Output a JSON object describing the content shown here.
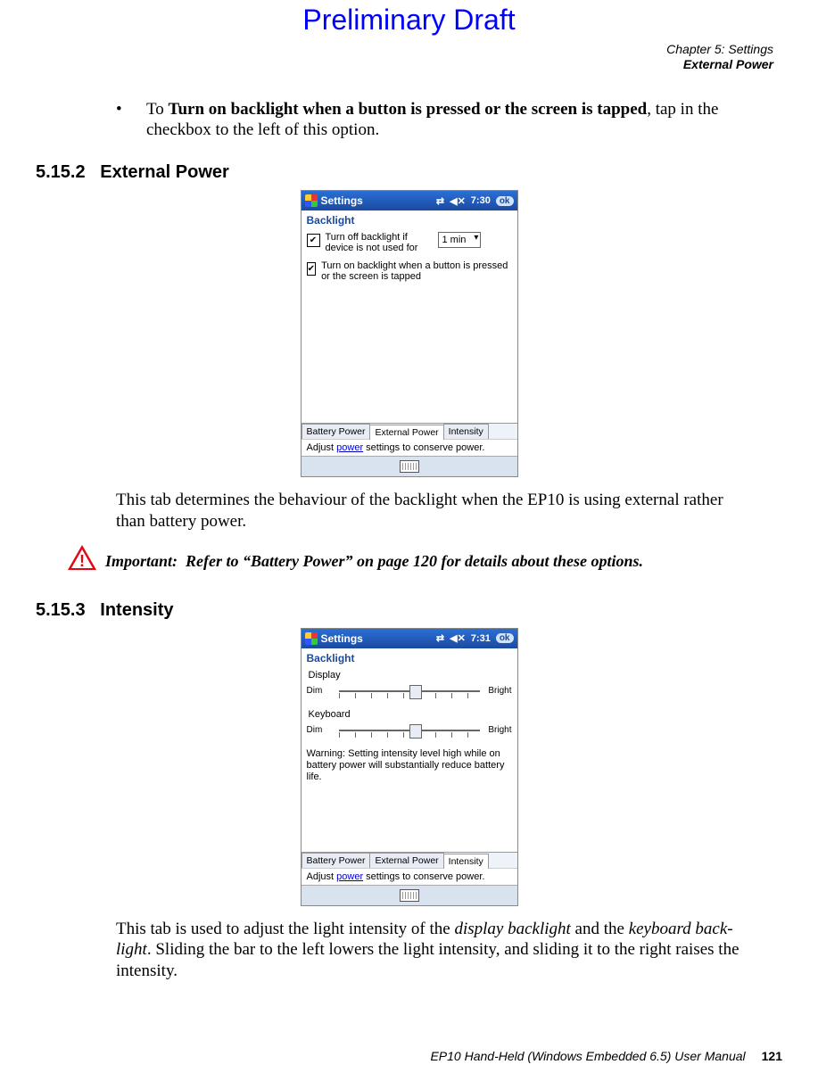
{
  "preliminary": "Preliminary Draft",
  "header": {
    "line1": "Chapter 5:  Settings",
    "line2": "External Power"
  },
  "bullet1": {
    "pre": "To ",
    "bold": "Turn on backlight when a button is pressed or the screen is tapped",
    "post": ", tap in the checkbox to the left of this option."
  },
  "sec1": {
    "num": "5.15.2",
    "title": "External Power"
  },
  "shot1": {
    "title": "Settings",
    "time": "7:30",
    "ok": "ok",
    "subtitle": "Backlight",
    "opt1": "Turn off backlight if device is not used for",
    "select1": "1 min",
    "opt2": "Turn on backlight when a button is pressed or the screen is tapped",
    "tabs": [
      "Battery Power",
      "External Power",
      "Intensity"
    ],
    "hint_pre": "Adjust ",
    "hint_link": "power",
    "hint_post": " settings to conserve power."
  },
  "para1": "This tab determines the behaviour of the backlight when the EP10 is using external rather than battery power.",
  "important": {
    "label": "Important:",
    "text": "Refer to “Battery Power” on page 120 for details about these options."
  },
  "sec2": {
    "num": "5.15.3",
    "title": "Intensity"
  },
  "shot2": {
    "title": "Settings",
    "time": "7:31",
    "ok": "ok",
    "subtitle": "Backlight",
    "display_label": "Display",
    "dim": "Dim",
    "bright": "Bright",
    "keyboard_label": "Keyboard",
    "warn": "Warning: Setting intensity level high while on battery power will substantially reduce battery life.",
    "tabs": [
      "Battery Power",
      "External Power",
      "Intensity"
    ],
    "hint_pre": "Adjust ",
    "hint_link": "power",
    "hint_post": " settings to conserve power."
  },
  "para2": {
    "t1": "This tab is used to adjust the light intensity of the ",
    "i1": "display backlight",
    "t2": " and the ",
    "i2": "keyboard back-light",
    "t3": ". Sliding the bar to the left lowers the light intensity, and sliding it to the right raises the intensity."
  },
  "footer": {
    "text": "EP10 Hand-Held (Windows Embedded 6.5) User Manual",
    "page": "121"
  }
}
